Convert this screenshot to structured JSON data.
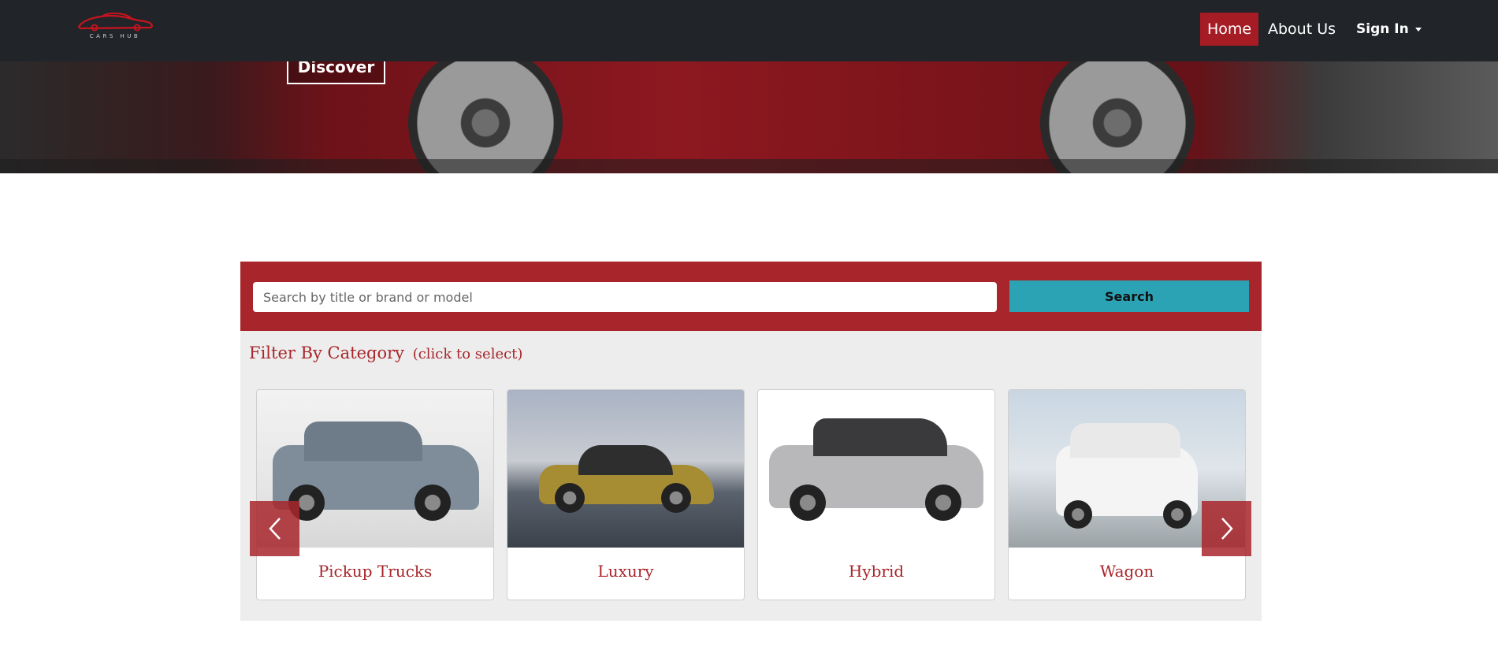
{
  "brand": {
    "logo_text": "CARS HUB",
    "accent": "#a8262b"
  },
  "nav": {
    "home": "Home",
    "about": "About Us",
    "signin": "Sign In"
  },
  "hero": {
    "discover_label": "Discover"
  },
  "search": {
    "placeholder": "Search by title or brand or model",
    "value": "",
    "button_label": "Search"
  },
  "filter": {
    "title": "Filter By Category",
    "hint": "(click to select)",
    "categories": [
      {
        "label": "Pickup Trucks"
      },
      {
        "label": "Luxury"
      },
      {
        "label": "Hybrid"
      },
      {
        "label": "Wagon"
      }
    ],
    "prev_icon": "chevron-left-icon",
    "next_icon": "chevron-right-icon"
  }
}
